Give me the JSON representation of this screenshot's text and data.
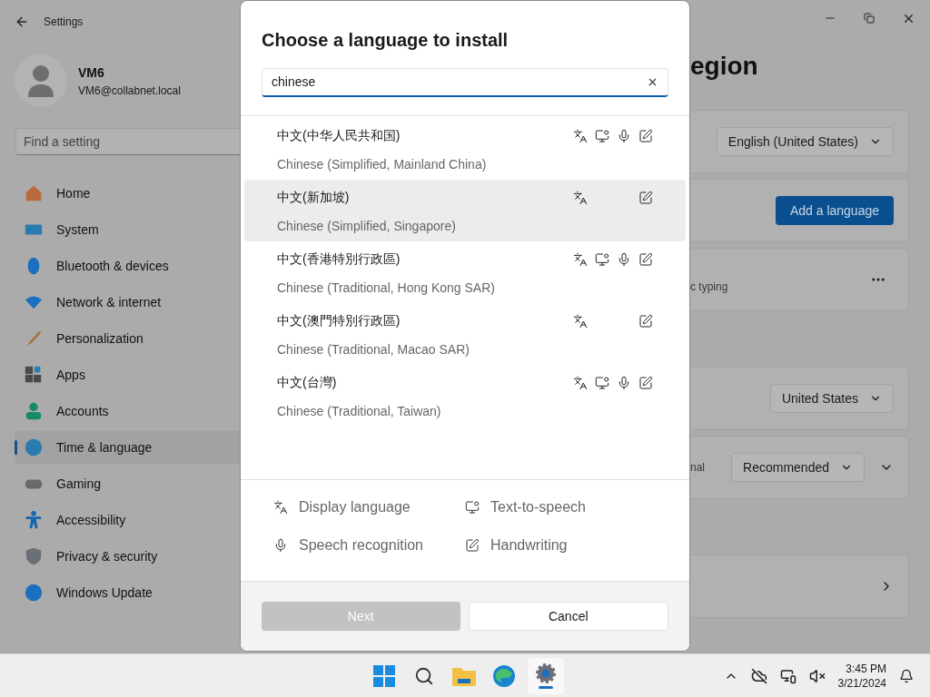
{
  "window": {
    "title": "Settings"
  },
  "account": {
    "name": "VM6",
    "email": "VM6@collabnet.local"
  },
  "sidebar": {
    "search": {
      "placeholder": "Find a setting"
    },
    "items": [
      {
        "label": "Home",
        "selected": false
      },
      {
        "label": "System",
        "selected": false
      },
      {
        "label": "Bluetooth & devices",
        "selected": false
      },
      {
        "label": "Network & internet",
        "selected": false
      },
      {
        "label": "Personalization",
        "selected": false
      },
      {
        "label": "Apps",
        "selected": false
      },
      {
        "label": "Accounts",
        "selected": false
      },
      {
        "label": "Time & language",
        "selected": true
      },
      {
        "label": "Gaming",
        "selected": false
      },
      {
        "label": "Accessibility",
        "selected": false
      },
      {
        "label": "Privacy & security",
        "selected": false
      },
      {
        "label": "Windows Update",
        "selected": false
      }
    ]
  },
  "page": {
    "title": "egion",
    "cards": [
      {
        "kind": "dropdown",
        "value": "English (United States)"
      },
      {
        "kind": "button",
        "value": "Add a language"
      },
      {
        "kind": "more",
        "text": "c typing"
      },
      {
        "kind": "gap"
      },
      {
        "kind": "dropdown",
        "value": "United States"
      },
      {
        "kind": "dropdown-expand",
        "text": "nal",
        "value": "Recommended"
      },
      {
        "kind": "gap"
      },
      {
        "kind": "link"
      }
    ]
  },
  "dialog": {
    "title": "Choose a language to install",
    "search": {
      "value": "chinese"
    },
    "languages": [
      {
        "native": "中文(中华人民共和国)",
        "name": "Chinese (Simplified, Mainland China)",
        "highlighted": false,
        "display": true,
        "tts": true,
        "speech": true,
        "handwriting": true
      },
      {
        "native": "中文(新加坡)",
        "name": "Chinese (Simplified, Singapore)",
        "highlighted": true,
        "display": true,
        "tts": false,
        "speech": false,
        "handwriting": true
      },
      {
        "native": "中文(香港特別行政區)",
        "name": "Chinese (Traditional, Hong Kong SAR)",
        "highlighted": false,
        "display": true,
        "tts": true,
        "speech": true,
        "handwriting": true
      },
      {
        "native": "中文(澳門特別行政區)",
        "name": "Chinese (Traditional, Macao SAR)",
        "highlighted": false,
        "display": true,
        "tts": false,
        "speech": false,
        "handwriting": true
      },
      {
        "native": "中文(台灣)",
        "name": "Chinese (Traditional, Taiwan)",
        "highlighted": false,
        "display": true,
        "tts": true,
        "speech": true,
        "handwriting": true
      }
    ],
    "legend": [
      {
        "kind": "display",
        "label": "Display language"
      },
      {
        "kind": "tts",
        "label": "Text-to-speech"
      },
      {
        "kind": "speech",
        "label": "Speech recognition"
      },
      {
        "kind": "handwriting",
        "label": "Handwriting"
      }
    ],
    "buttons": [
      {
        "label": "Next",
        "disabled": true
      },
      {
        "label": "Cancel",
        "disabled": false
      }
    ]
  },
  "taskbar": {
    "time": "3:45 PM",
    "date": "3/21/2024"
  }
}
